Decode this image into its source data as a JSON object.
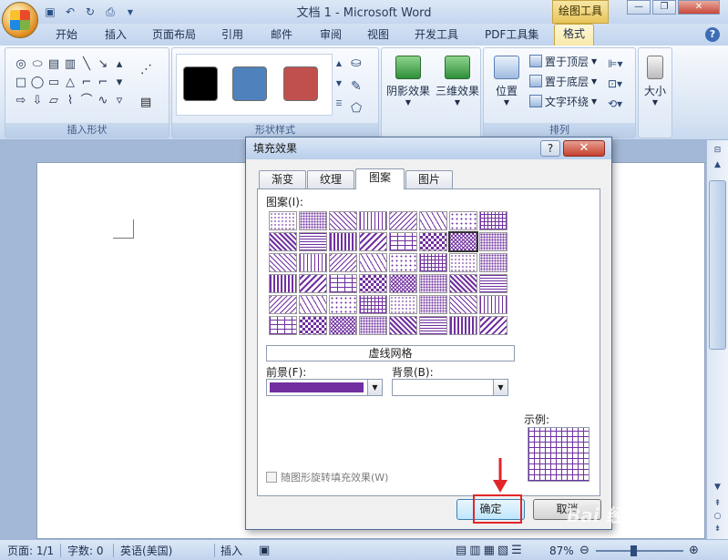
{
  "window": {
    "title": "文档 1 - Microsoft Word",
    "contextual_tools_label": "绘图工具",
    "controls": [
      "minimize",
      "restore",
      "close"
    ]
  },
  "quick_access": [
    "save-icon",
    "undo-icon",
    "redo-icon",
    "print-preview-icon"
  ],
  "tabs": [
    {
      "label": "开始",
      "active": false
    },
    {
      "label": "插入",
      "active": false
    },
    {
      "label": "页面布局",
      "active": false
    },
    {
      "label": "引用",
      "active": false
    },
    {
      "label": "邮件",
      "active": false
    },
    {
      "label": "审阅",
      "active": false
    },
    {
      "label": "视图",
      "active": false
    },
    {
      "label": "开发工具",
      "active": false
    },
    {
      "label": "PDF工具集",
      "active": false
    },
    {
      "label": "格式",
      "active": true
    }
  ],
  "ribbon": {
    "insert_shapes_label": "插入形状",
    "shape_styles_label": "形状样式",
    "shadow_effects_label": "阴影效果",
    "3d_effects_label": "三维效果",
    "position_label": "位置",
    "bring_to_front_label": "置于顶层",
    "send_to_back_label": "置于底层",
    "text_wrap_label": "文字环绕",
    "arrange_label": "排列",
    "size_label": "大小",
    "style_swatches": [
      "#000000",
      "#4f81bd",
      "#c0504d"
    ]
  },
  "dialog": {
    "title": "填充效果",
    "help_symbol": "?",
    "close_symbol": "✕",
    "tabs": [
      {
        "label": "渐变",
        "active": false
      },
      {
        "label": "纹理",
        "active": false
      },
      {
        "label": "图案",
        "active": true
      },
      {
        "label": "图片",
        "active": false
      }
    ],
    "pattern_label": "图案(I):",
    "selected_pattern_name": "虚线网格",
    "foreground_label": "前景(F):",
    "background_label": "背景(B):",
    "foreground_color": "#7030a0",
    "background_color": "#ffffff",
    "sample_label": "示例:",
    "rotate_checkbox_label": "随图形旋转填充效果(W)",
    "rotate_checked": false,
    "ok_label": "确定",
    "cancel_label": "取消"
  },
  "statusbar": {
    "page": "页面: 1/1",
    "words": "字数: 0",
    "language": "英语(美国)",
    "insert_mode": "插入",
    "zoom": "87%"
  },
  "annotation": {
    "highlight_color": "#e0262a"
  },
  "watermark": {
    "text": "Bai 经验",
    "url": "jingyan.baidu.com"
  }
}
